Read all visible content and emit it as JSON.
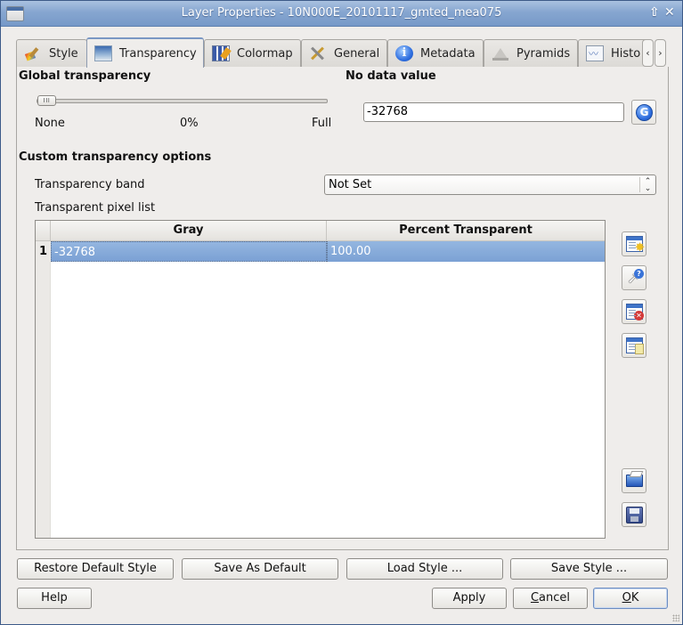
{
  "window": {
    "title": "Layer Properties - 10N000E_20101117_gmted_mea075"
  },
  "tabs": [
    {
      "label": "Style",
      "icon": "style-brush-icon",
      "active": false
    },
    {
      "label": "Transparency",
      "icon": "transparency-icon",
      "active": true
    },
    {
      "label": "Colormap",
      "icon": "colormap-icon",
      "active": false
    },
    {
      "label": "General",
      "icon": "tools-icon",
      "active": false
    },
    {
      "label": "Metadata",
      "icon": "info-icon",
      "active": false
    },
    {
      "label": "Pyramids",
      "icon": "pyramid-icon",
      "active": false
    },
    {
      "label": "Histo",
      "icon": "histogram-icon",
      "active": false
    }
  ],
  "tab_scroll": {
    "left": "‹",
    "right": "›"
  },
  "global_transparency": {
    "heading": "Global transparency",
    "min_label": "None",
    "value_label": "0%",
    "max_label": "Full",
    "value_percent": 0,
    "handle_grip": "III"
  },
  "no_data": {
    "heading": "No data value",
    "value": "-32768"
  },
  "custom": {
    "heading": "Custom transparency options",
    "band_label": "Transparency band",
    "band_selected": "Not Set",
    "pixel_list_label": "Transparent pixel list"
  },
  "table": {
    "columns": [
      "Gray",
      "Percent Transparent"
    ],
    "rows": [
      {
        "num": "1",
        "gray": "-32768",
        "percent": "100.00",
        "selected": true
      }
    ]
  },
  "side_buttons": [
    {
      "name": "add-value-manually-button",
      "icon": "table-add-icon"
    },
    {
      "name": "add-from-display-button",
      "icon": "pointer-help-icon"
    },
    {
      "name": "remove-value-button",
      "icon": "table-remove-icon"
    },
    {
      "name": "default-values-button",
      "icon": "table-default-icon"
    },
    {
      "name": "import-from-file-button",
      "icon": "folder-open-icon"
    },
    {
      "name": "export-to-file-button",
      "icon": "floppy-save-icon"
    }
  ],
  "style_buttons": {
    "restore": "Restore Default Style",
    "save_default": "Save As Default",
    "load": "Load Style ...",
    "save": "Save Style ..."
  },
  "dialog_buttons": {
    "help": "Help",
    "apply": "Apply",
    "cancel_pre": "",
    "cancel_mn": "C",
    "cancel_post": "ancel",
    "ok_mn": "O",
    "ok_post": "K"
  },
  "titlebar_buttons": {
    "shade": "🡅",
    "close": "✕"
  }
}
